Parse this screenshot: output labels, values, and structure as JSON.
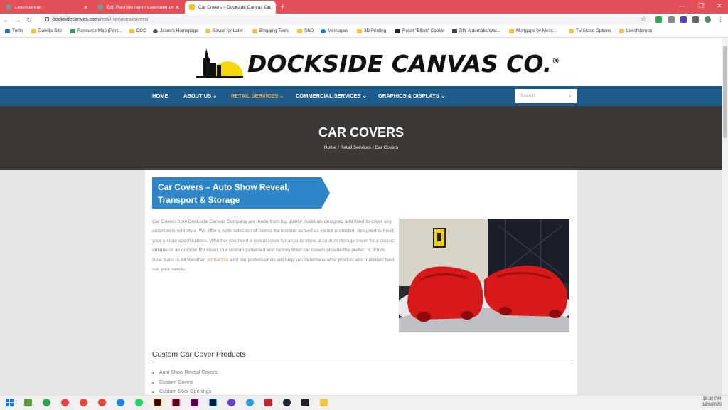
{
  "browser": {
    "tabs": [
      {
        "title": "Leechdemon"
      },
      {
        "title": "Edit Portfolio Item ‹ Leechdemon"
      },
      {
        "title": "Car Covers – Dockside Canvas Co"
      }
    ],
    "url_host": "docksidecanvas.com",
    "url_path": "/retail-services/covers/",
    "bookmarks": [
      "Trello",
      "David's Site",
      "Resource Map (Pers...",
      "DCC",
      "Jason's Homepage",
      "Saved for Later",
      "Blogging Tools",
      "SND",
      "Messages",
      "3D Printing",
      "Reset \"Elliott\" Cookie",
      "DIY Automatic Wat...",
      "Mortgage by Mess...",
      "TV Stand Options",
      "Leechdemon"
    ]
  },
  "site": {
    "logo_text": "DOCKSIDE CANVAS CO.",
    "logo_mark": "®",
    "nav": [
      "HOME",
      "ABOUT US",
      "RETAIL SERVICES",
      "COMMERCIAL SERVICES",
      "GRAPHICS & DISPLAYS"
    ],
    "search_placeholder": "Search",
    "hero_title": "CAR COVERS",
    "breadcrumb": "Home / Retail Services / Car Covers",
    "banner_title": "Car Covers – Auto Show Reveal, Transport & Storage",
    "para_before": "Car Covers from Dockside Canvas Company are made from top quality materials designed and fitted to cover any automobile with style. We offer a wide selection of fabrics for outdoor as well as indoor protection designed to meet your unique specifications. Whether you need a reveal cover for an auto show, a custom storage cover for a classic antique or an outdoor RV cover, our custom patterned and factory fitted car covers provide the perfect fit. From Strie Satin to All Weather, ",
    "para_link": "contact us",
    "para_after": " and our professionals will help you determine what product and materials best suit your needs.",
    "products_heading": "Custom Car Cover Products",
    "products": [
      "Auto Show Reveal Covers",
      "Custom Covers",
      "Custom Door Openings"
    ]
  },
  "taskbar": {
    "time": "10:30 PM",
    "date": "12/9/2020"
  },
  "colors": {
    "tabbar": "#e4505a",
    "nav": "#1d5c8a",
    "hero": "#3b3835",
    "banner": "#2e86c9",
    "accent": "#f0a444"
  }
}
